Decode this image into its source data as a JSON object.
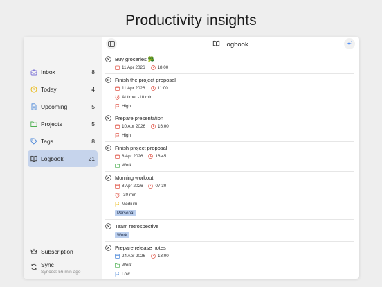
{
  "headline": "Productivity insights",
  "colors": {
    "accent": "#3b82f6",
    "active_bg": "#c6d4ec",
    "red": "#e0574a",
    "green": "#4caf50",
    "yellow": "#e8b400",
    "tag_bg": "#bcd0ef"
  },
  "toolbar": {
    "title": "Logbook",
    "title_icon": "book-icon",
    "left_icon": "sidebar-toggle-icon",
    "right_icon": "sparkle-icon"
  },
  "sidebar": {
    "items": [
      {
        "label": "Inbox",
        "count": "8",
        "icon": "inbox-icon"
      },
      {
        "label": "Today",
        "count": "4",
        "icon": "clock-icon"
      },
      {
        "label": "Upcoming",
        "count": "5",
        "icon": "document-icon"
      },
      {
        "label": "Projects",
        "count": "5",
        "icon": "folder-icon"
      },
      {
        "label": "Tags",
        "count": "8",
        "icon": "tag-icon"
      },
      {
        "label": "Logbook",
        "count": "21",
        "icon": "book-icon",
        "active": true
      }
    ],
    "subscription": {
      "label": "Subscription",
      "icon": "crown-icon"
    },
    "sync": {
      "label": "Sync",
      "sub": "Synced: 56 min ago",
      "icon": "sync-icon"
    }
  },
  "tasks": [
    {
      "title": "Buy groceries 🥦",
      "date": "11 Apr 2026",
      "time": "18:00"
    },
    {
      "title": "Finish the project proposal",
      "date": "11 Apr 2026",
      "time": "11:00",
      "reminder": "At time; -10 min",
      "priority": "High"
    },
    {
      "title": "Prepare presentation",
      "date": "10 Apr 2026",
      "time": "16:00",
      "priority": "High"
    },
    {
      "title": "Finish project proposal",
      "date": "8 Apr 2026",
      "time": "16:45",
      "project": "Work"
    },
    {
      "title": "Morning workout",
      "date": "8 Apr 2026",
      "time": "07:30",
      "reminder": "-30 min",
      "priority": "Medium",
      "tag": "Personal"
    },
    {
      "title": "Team retrospective",
      "tag": "Work"
    },
    {
      "title": "Prepare release notes",
      "date": "24 Apr 2026",
      "time": "13:00",
      "project": "Work",
      "priority": "Low"
    }
  ]
}
